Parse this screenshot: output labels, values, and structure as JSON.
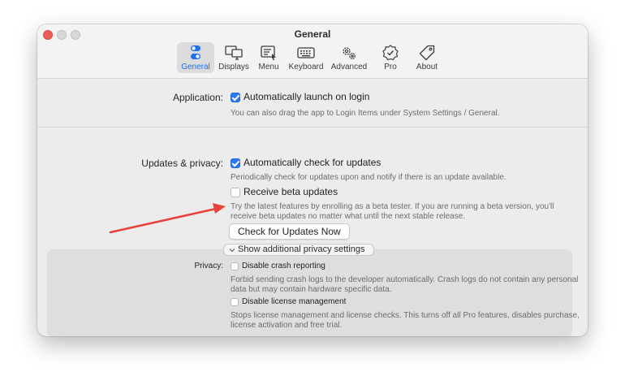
{
  "window": {
    "title": "General"
  },
  "toolbar": {
    "items": [
      {
        "label": "General",
        "icon": "toggles-icon",
        "active": true
      },
      {
        "label": "Displays",
        "icon": "displays-icon",
        "active": false
      },
      {
        "label": "Menu",
        "icon": "menu-icon",
        "active": false
      },
      {
        "label": "Keyboard",
        "icon": "keyboard-icon",
        "active": false
      },
      {
        "label": "Advanced",
        "icon": "gears-icon",
        "active": false
      },
      {
        "label": "Pro",
        "icon": "badge-check-icon",
        "active": false
      },
      {
        "label": "About",
        "icon": "tag-icon",
        "active": false
      }
    ]
  },
  "application": {
    "label": "Application:",
    "launch_on_login": {
      "label": "Automatically launch on login",
      "checked": true
    },
    "help": "You can also drag the app to Login Items under System Settings / General."
  },
  "updates": {
    "label": "Updates & privacy:",
    "auto_check": {
      "label": "Automatically check for updates",
      "checked": true
    },
    "auto_check_help": "Periodically check for updates upon and notify if there is an update available.",
    "beta": {
      "label": "Receive beta updates",
      "checked": false
    },
    "beta_help_line1": "Try the latest features by enrolling as a beta tester. If you are running a beta version, you'll",
    "beta_help_line2": "receive beta updates no matter what until the next stable release.",
    "check_now_button": "Check for Updates Now"
  },
  "privacy": {
    "disclosure_label": "Show additional privacy settings",
    "label": "Privacy:",
    "crash": {
      "label": "Disable crash reporting",
      "checked": false
    },
    "crash_help_line1": "Forbid sending crash logs to the developer automatically. Crash logs do not contain any personal",
    "crash_help_line2": "data but may contain hardware specific data.",
    "license": {
      "label": "Disable license management",
      "checked": false
    },
    "license_help_line1": "Stops license management and license checks. This turns off all Pro features, disables purchase,",
    "license_help_line2": "license activation and free trial."
  },
  "colors": {
    "accent": "#2a78f5",
    "annotation_arrow": "#e8413a"
  }
}
